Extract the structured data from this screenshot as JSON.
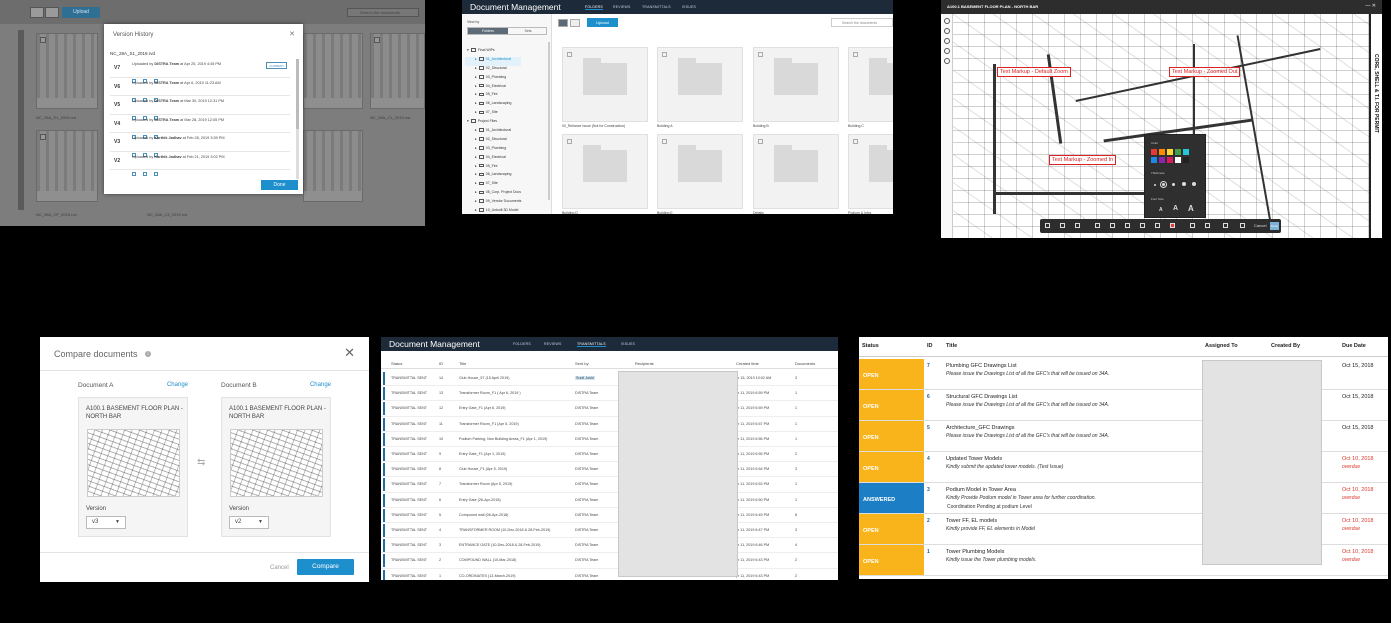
{
  "version_history": {
    "upload_label": "Upload",
    "search_placeholder": "Search the documents",
    "dialog_title": "Version History",
    "file_name": "NC_28A_S1_2019.rvd",
    "current_badge": "CURRENT",
    "done_label": "Done",
    "versions": [
      {
        "v": "V7",
        "by": "DISTRA Team",
        "date": "Apr 25, 2019 4:45 PM"
      },
      {
        "v": "V6",
        "by": "DISTRA Team",
        "date": "Apr 6, 2019 11:23 AM"
      },
      {
        "v": "V5",
        "by": "DISTRA Team",
        "date": "Mar 30, 2019 12:31 PM"
      },
      {
        "v": "V4",
        "by": "DISTRA Team",
        "date": "Mar 28, 2019 12:05 PM"
      },
      {
        "v": "V3",
        "by": "Karthik Jadhav",
        "date": "Feb 28, 2019 3:39 PM"
      },
      {
        "v": "V2",
        "by": "Karthik Jadhav",
        "date": "Feb 21, 2019 3:02 PM"
      }
    ],
    "captions": [
      "NC_28A_S1_2019.rvd",
      "NC_28A_C1_2019.rvd",
      "NC_28A_CP_2019.rvd",
      "NC_28A_C3_2019.rvd"
    ]
  },
  "folders": {
    "app_title": "Document Management",
    "nav": [
      "FOLDERS",
      "REVIEWS",
      "TRANSMITTALS",
      "ISSUES"
    ],
    "view_by": "View by",
    "seg_folders": "Folders",
    "seg_sets": "Sets",
    "upload_label": "Upload",
    "search_placeholder": "Search the documents",
    "tree": [
      "Final WIPs",
      "01_Architectural",
      "02_Structural",
      "03_Plumbing",
      "04_Electrical",
      "05_Fire",
      "06_Landscaping",
      "07_Site",
      "Project Files",
      "01_Architectural",
      "02_Structural",
      "03_Plumbing",
      "04_Electrical",
      "05_Fire",
      "06_Landscaping",
      "07_Site",
      "08_Corp. Project Docs",
      "09_Vendor Documents",
      "10_Unbuilt 3D Model"
    ],
    "cards": [
      "00_Reliance Issue (Not for Construction)",
      "Building A",
      "Building B",
      "Building C",
      "Building D",
      "Building E",
      "Details",
      "Podium & Infra"
    ]
  },
  "viewer": {
    "sheet_title": "A100.1 BASEMENT FLOOR PLAN - NORTH BAR",
    "title_block": "CORE, SHELL & T.I. FOR PERMIT",
    "markups": [
      "Text Markup - Default Zoom",
      "Text Markup - Zoomed Out",
      "Text Markup - Zoomed In"
    ],
    "picker_labels": [
      "Color",
      "Thickness",
      "Font Size"
    ],
    "picker_colors": [
      "#e53935",
      "#fb8c00",
      "#fdd835",
      "#43a047",
      "#26c6da",
      "#1e88e5",
      "#8e24aa",
      "#d81b60",
      "#ffffff",
      "#212121"
    ],
    "font_sizes": [
      "A",
      "A",
      "A"
    ],
    "cancel_label": "Cancel",
    "done_label": "Done"
  },
  "compare": {
    "title": "Compare documents",
    "doc_a_label": "Document A",
    "doc_b_label": "Document B",
    "change_label": "Change",
    "doc_name": "A100.1 BASEMENT FLOOR PLAN - NORTH BAR",
    "version_label": "Version",
    "version_a": "v3",
    "version_b": "v2",
    "cancel_label": "Cancel",
    "compare_label": "Compare"
  },
  "transmittals": {
    "app_title": "Document Management",
    "nav": [
      "FOLDERS",
      "REVIEWS",
      "TRANSMITTALS",
      "ISSUES"
    ],
    "columns": [
      "Status",
      "ID",
      "Title",
      "Sent by",
      "Recipients",
      "Created time",
      "Documents"
    ],
    "rows": [
      {
        "status": "TRANSMITTAL SENT",
        "id": "14",
        "title": "Club House_57 (15 April 2019)",
        "by": "Sunil Joshi",
        "time": "pr 15, 2019 10:02 AM",
        "docs": "3"
      },
      {
        "status": "TRANSMITTAL SENT",
        "id": "13",
        "title": "Transformer Room_F1 ( Apr 6, 2019 )",
        "by": "DISTRA Team",
        "time": "pr 11, 2019 6:59 PM",
        "docs": "1"
      },
      {
        "status": "TRANSMITTAL SENT",
        "id": "12",
        "title": "Entry Gate_F1 (Apr 6, 2019)",
        "by": "DISTRA Team",
        "time": "pr 11, 2019 6:59 PM",
        "docs": "1"
      },
      {
        "status": "TRANSMITTAL SENT",
        "id": "11",
        "title": "Transformer Room_F1 (Apr 5, 2019)",
        "by": "DISTRA Team",
        "time": "pr 11, 2019 6:57 PM",
        "docs": "1"
      },
      {
        "status": "TRANSMITTAL SENT",
        "id": "10",
        "title": "Podium Parking, Non Building Areas_F1 (Apr 1, 2019)",
        "by": "DISTRA Team",
        "time": "pr 11, 2019 6:56 PM",
        "docs": "1"
      },
      {
        "status": "TRANSMITTAL SENT",
        "id": "9",
        "title": "Entry Gate_F1 (Apr 1, 2019)",
        "by": "DISTRA Team",
        "time": "pr 11, 2019 6:55 PM",
        "docs": "2"
      },
      {
        "status": "TRANSMITTAL SENT",
        "id": "8",
        "title": "Club House_F1 (Apr 5, 2019)",
        "by": "DISTRA Team",
        "time": "pr 11, 2019 6:54 PM",
        "docs": "3"
      },
      {
        "status": "TRANSMITTAL SENT",
        "id": "7",
        "title": "Transformer Room (Apr 5, 2019)",
        "by": "DISTRA Team",
        "time": "pr 11, 2019 6:53 PM",
        "docs": "1"
      },
      {
        "status": "TRANSMITTAL SENT",
        "id": "6",
        "title": "Entry Gate (26-Apr-2018)",
        "by": "DISTRA Team",
        "time": "pr 11, 2019 6:50 PM",
        "docs": "1"
      },
      {
        "status": "TRANSMITTAL SENT",
        "id": "5",
        "title": "Compound wall (06-Apr-2018)",
        "by": "DISTRA Team",
        "time": "pr 11, 2019 6:49 PM",
        "docs": "8"
      },
      {
        "status": "TRANSMITTAL SENT",
        "id": "4",
        "title": "TRANSFORMER ROOM (10-Dec-2018 & 28-Feb-2019)",
        "by": "DISTRA Team",
        "time": "pr 11, 2019 6:47 PM",
        "docs": "3"
      },
      {
        "status": "TRANSMITTAL SENT",
        "id": "3",
        "title": "ENTRANCE GATE (10-Dec-2018 & 28-Feb-2019)",
        "by": "DISTRA Team",
        "time": "pr 11, 2019 6:46 PM",
        "docs": "4"
      },
      {
        "status": "TRANSMITTAL SENT",
        "id": "2",
        "title": "COMPOUND WALL (10-Mar-2018)",
        "by": "DISTRA Team",
        "time": "pr 11, 2019 6:43 PM",
        "docs": "2"
      },
      {
        "status": "TRANSMITTAL SENT",
        "id": "1",
        "title": "CO-ORDINATES (13-March-2019)",
        "by": "DISTRA Team",
        "time": "pr 11, 2019 6:43 PM",
        "docs": "2"
      }
    ]
  },
  "issues": {
    "columns": [
      "Status",
      "ID",
      "Title",
      "Assigned To",
      "Created By",
      "Due Date"
    ],
    "rows": [
      {
        "status": "OPEN",
        "kind": "open",
        "id": "7",
        "title": "Plumbing GFC Drawings List",
        "desc": "Please issue the Drawings List of all the GFC's that will be issued on 34A.",
        "desc2": "",
        "due": "Oct 15, 2018",
        "overdue": ""
      },
      {
        "status": "OPEN",
        "kind": "open",
        "id": "6",
        "title": "Structural GFC Drawings List",
        "desc": "Please issue the Drawings List of all the GFC's that will be issued on 34A.",
        "desc2": "",
        "due": "Oct 15, 2018",
        "overdue": ""
      },
      {
        "status": "OPEN",
        "kind": "open",
        "id": "5",
        "title": "Architecture_GFC Drawings",
        "desc": "Please issue the Drawings List of all the GFC's that will be issued on 34A.",
        "desc2": "",
        "due": "Oct 15, 2018",
        "overdue": ""
      },
      {
        "status": "OPEN",
        "kind": "open",
        "id": "4",
        "title": "Updated Tower Models",
        "desc": "Kindly submit the updated tower models. (Test Issue)",
        "desc2": "",
        "due": "Oct 10, 2018",
        "overdue": "overdue"
      },
      {
        "status": "ANSWERED",
        "kind": "answered",
        "id": "3",
        "title": "Podium Model in Tower Area",
        "desc": "Kindly Provide Podium model in Tower area for further coordination.",
        "desc2": "Coordination Pending at podium Level",
        "due": "Oct 10, 2018",
        "overdue": "overdue"
      },
      {
        "status": "OPEN",
        "kind": "open",
        "id": "2",
        "title": "Tower FF, EL models",
        "desc": "Kindly provide FF, EL elements in Model",
        "desc2": "",
        "due": "Oct 10, 2018",
        "overdue": "overdue"
      },
      {
        "status": "OPEN",
        "kind": "open",
        "id": "1",
        "title": "Tower Plumbing Models",
        "desc": "Kindly issue the Tower plumbing models.",
        "desc2": "",
        "due": "Oct 10, 2018",
        "overdue": "overdue"
      }
    ]
  }
}
